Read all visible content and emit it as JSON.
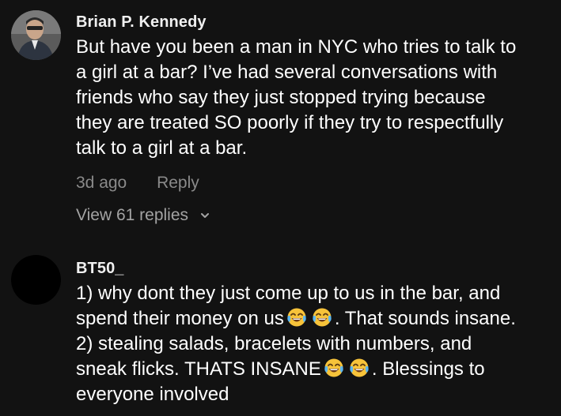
{
  "comments": [
    {
      "username": "Brian P. Kennedy",
      "lines": [
        "But have you been a man in NYC who tries to talk to",
        "a girl at a bar? I’ve had several conversations with",
        "friends who say they just stopped trying because",
        "they are treated SO poorly if they try to respectfully",
        "talk to a girl at a bar."
      ],
      "time": "3d ago",
      "reply_label": "Reply",
      "view_replies": "View 61 replies"
    },
    {
      "username": "BT50_",
      "line1": "1) why dont they just come up to us in the bar, and",
      "line2_a": "spend their money on us",
      "line2_b": ". That sounds insane.",
      "line3": "2) stealing salads, bracelets with numbers, and",
      "line4_a": "sneak flicks. THATS INSANE",
      "line4_b": ". Blessings to",
      "line5": "everyone involved",
      "emoji_name": "face-with-tears-of-joy-icon"
    }
  ],
  "colors": {
    "background": "#121212",
    "text": "#ffffff",
    "muted": "#8a8a8a",
    "emoji_yellow": "#f7c33a"
  }
}
